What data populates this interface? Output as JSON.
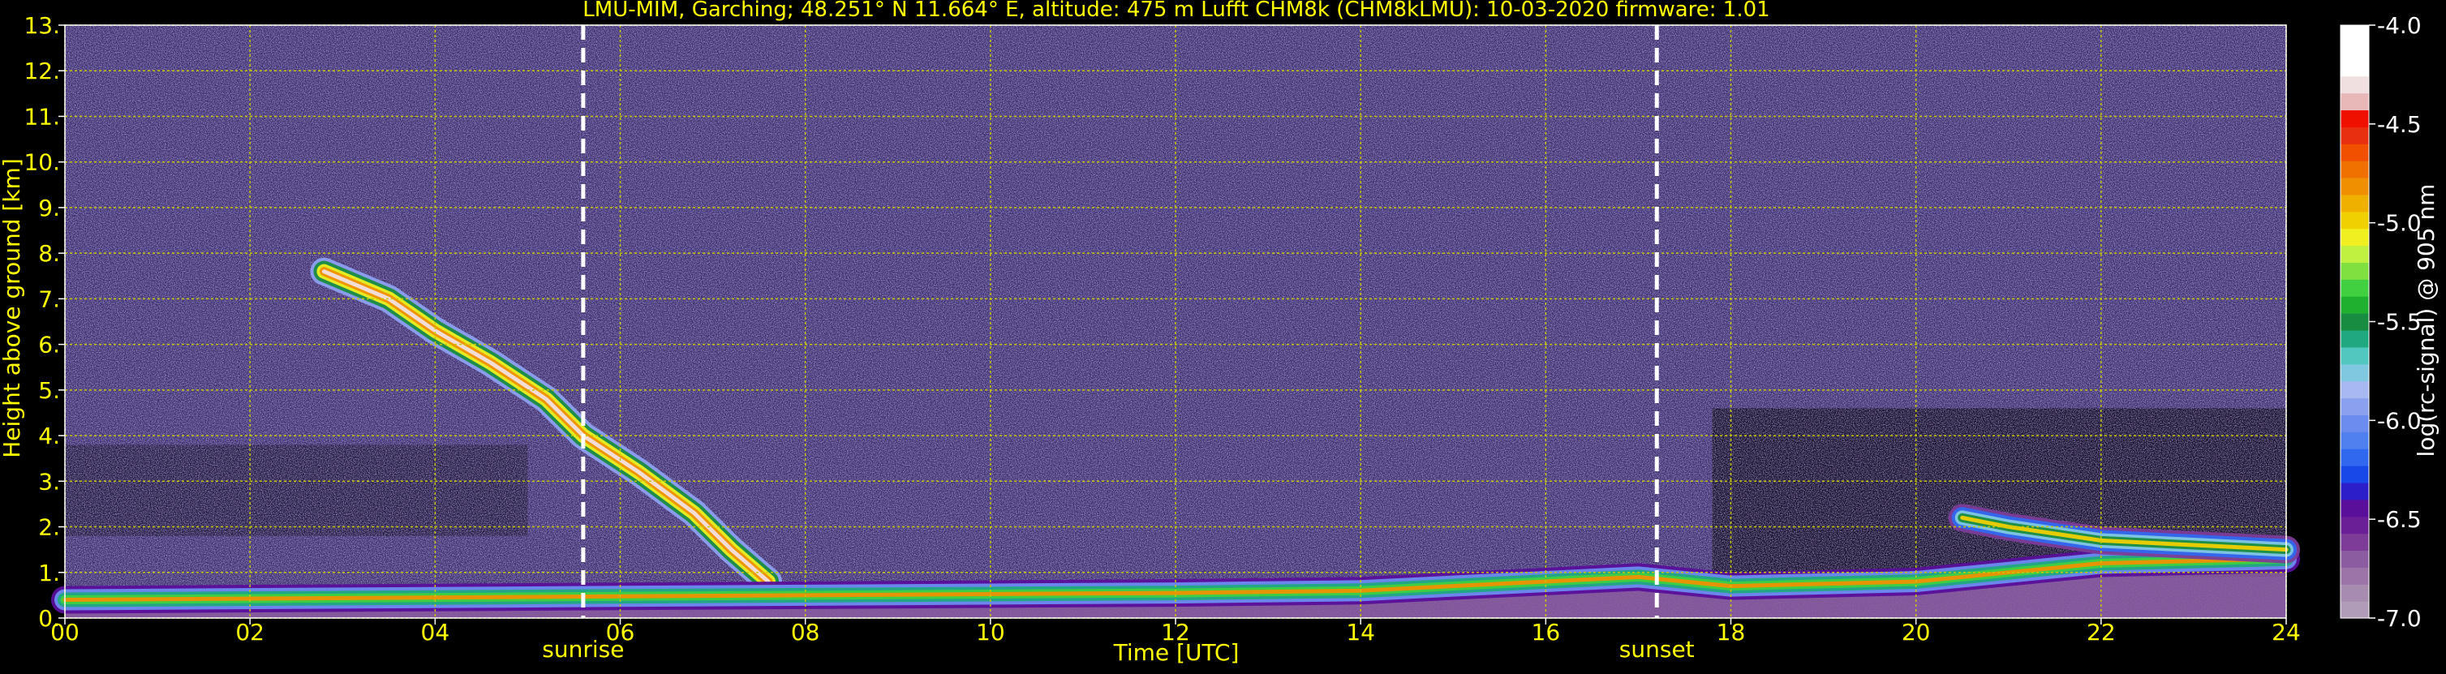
{
  "title": "LMU-MIM, Garching; 48.251° N 11.664° E, altitude: 475 m    Lufft CHM8k (CHM8kLMU): 10-03-2020    firmware: 1.01",
  "colors": {
    "text_yellow": "#ffff00",
    "grid": "#c8c800",
    "background": "#000000",
    "noise_bg": "#3a2d6b",
    "marker_line": "#ffffff"
  },
  "chart_data": {
    "type": "heatmap",
    "title": "LMU-MIM, Garching; 48.251° N 11.664° E, altitude: 475 m    Lufft CHM8k (CHM8kLMU): 10-03-2020    firmware: 1.01",
    "xlabel": "Time [UTC]",
    "ylabel": "Height above ground [km]",
    "xlim": [
      0,
      24
    ],
    "ylim": [
      0,
      13
    ],
    "x_ticks": [
      "00",
      "02",
      "04",
      "06",
      "08",
      "10",
      "12",
      "14",
      "16",
      "18",
      "20",
      "22",
      "24"
    ],
    "x_tick_values": [
      0,
      2,
      4,
      6,
      8,
      10,
      12,
      14,
      16,
      18,
      20,
      22,
      24
    ],
    "y_ticks": [
      "0.",
      "1.",
      "2.",
      "3.",
      "4.",
      "5.",
      "6.",
      "7.",
      "8.",
      "9.",
      "10.",
      "11.",
      "12.",
      "13."
    ],
    "y_tick_values": [
      0,
      1,
      2,
      3,
      4,
      5,
      6,
      7,
      8,
      9,
      10,
      11,
      12,
      13
    ],
    "grid": true,
    "markers": [
      {
        "label": "sunrise",
        "time": 5.6
      },
      {
        "label": "sunset",
        "time": 17.2
      }
    ],
    "colorbar": {
      "label": "log(rc-signal) @ 905 nm",
      "range": [
        -7.0,
        -4.0
      ],
      "ticks": [
        "-4.0",
        "-4.5",
        "-5.0",
        "-5.5",
        "-6.0",
        "-6.5",
        "-7.0"
      ],
      "tick_values": [
        -4.0,
        -4.5,
        -5.0,
        -5.5,
        -6.0,
        -6.5,
        -7.0
      ],
      "colors_low_to_high": [
        "#b09cb8",
        "#a88cb0",
        "#9c74a8",
        "#8c5ca0",
        "#7c3c98",
        "#6a1f96",
        "#5a0f9a",
        "#2c1ec8",
        "#1848e8",
        "#3068f0",
        "#5080f0",
        "#6c8cf0",
        "#8ca0f0",
        "#a8b8f0",
        "#80c8e0",
        "#50c8c0",
        "#20a880",
        "#188c40",
        "#20b030",
        "#40d040",
        "#80e040",
        "#c0f040",
        "#f0f020",
        "#f0d000",
        "#f0b000",
        "#f09000",
        "#f07000",
        "#f05000",
        "#e83010",
        "#f01000",
        "#e8b8b8",
        "#f0e0e0",
        "#ffffff",
        "#ffffff",
        "#ffffff"
      ]
    },
    "features": [
      {
        "name": "descending aerosol/cloud layer",
        "points": [
          [
            2.8,
            7.6
          ],
          [
            3.5,
            7.0
          ],
          [
            4.0,
            6.3
          ],
          [
            4.6,
            5.6
          ],
          [
            5.2,
            4.8
          ],
          [
            5.6,
            4.0
          ],
          [
            6.2,
            3.2
          ],
          [
            6.8,
            2.3
          ],
          [
            7.2,
            1.5
          ],
          [
            7.6,
            0.8
          ]
        ],
        "level": -4.5
      },
      {
        "name": "boundary layer",
        "points": [
          [
            0,
            0.4
          ],
          [
            8,
            0.5
          ],
          [
            12,
            0.55
          ],
          [
            14,
            0.6
          ],
          [
            16,
            0.8
          ],
          [
            17,
            0.9
          ],
          [
            18,
            0.7
          ],
          [
            20,
            0.8
          ],
          [
            22,
            1.2
          ],
          [
            24,
            1.3
          ]
        ],
        "level": -5.0
      },
      {
        "name": "residual layer",
        "points": [
          [
            20.5,
            2.2
          ],
          [
            21.0,
            2.0
          ],
          [
            22.0,
            1.7
          ],
          [
            23.0,
            1.6
          ],
          [
            24.0,
            1.5
          ]
        ],
        "level": -5.2
      }
    ]
  }
}
